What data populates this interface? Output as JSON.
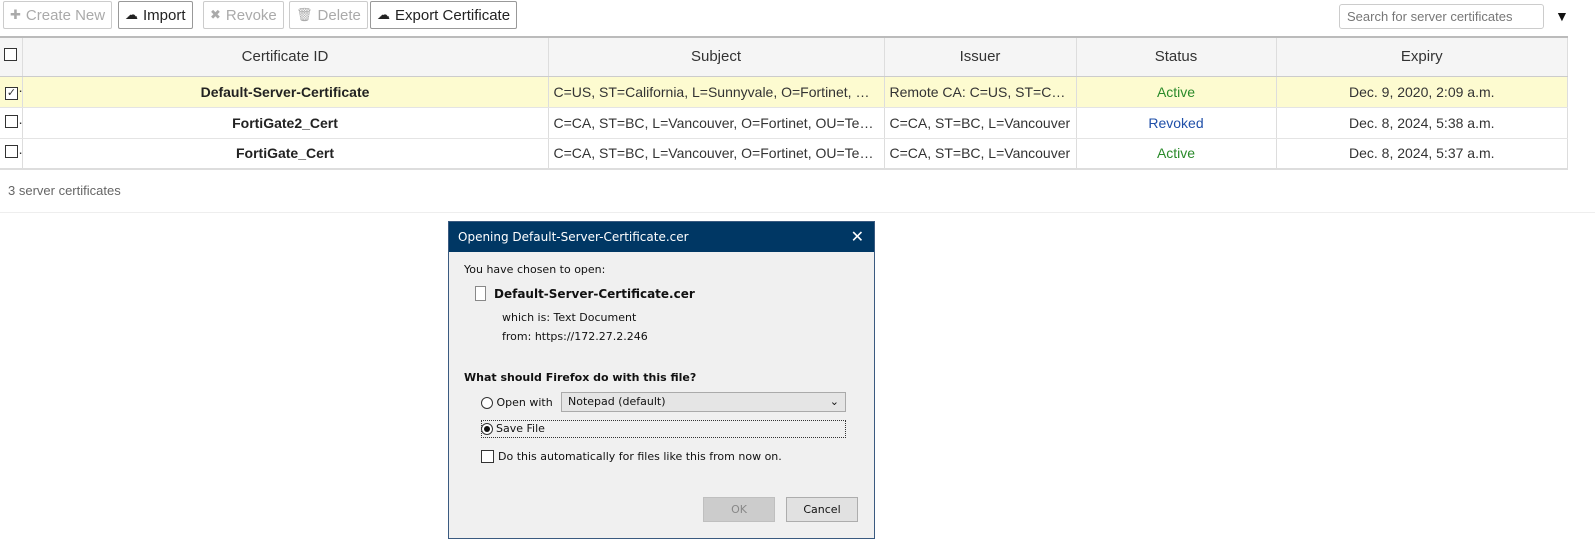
{
  "toolbar": {
    "create_new": "Create New",
    "import": "Import",
    "revoke": "Revoke",
    "delete": "Delete",
    "export": "Export Certificate",
    "search_placeholder": "Search for server certificates"
  },
  "table": {
    "headers": [
      "Certificate ID",
      "Subject",
      "Issuer",
      "Status",
      "Expiry"
    ],
    "rows": [
      {
        "id": "Default-Server-Certificate",
        "subject": "C=US, ST=California, L=Sunnyvale, O=Fortinet, OU=FortiGate",
        "issuer": "Remote CA: C=US, ST=California",
        "status": "Active",
        "expiry": "Dec. 9, 2020, 2:09 a.m.",
        "checked": true
      },
      {
        "id": "FortiGate2_Cert",
        "subject": "C=CA, ST=BC, L=Vancouver, O=Fortinet, OU=Technical",
        "issuer": "C=CA, ST=BC, L=Vancouver",
        "status": "Revoked",
        "expiry": "Dec. 8, 2024, 5:38 a.m.",
        "checked": false
      },
      {
        "id": "FortiGate_Cert",
        "subject": "C=CA, ST=BC, L=Vancouver, O=Fortinet, OU=Technical",
        "issuer": "C=CA, ST=BC, L=Vancouver",
        "status": "Active",
        "expiry": "Dec. 8, 2024, 5:37 a.m.",
        "checked": false
      }
    ]
  },
  "footer": {
    "count": "3 server certificates"
  },
  "dialog": {
    "title": "Opening Default-Server-Certificate.cer",
    "chosen": "You have chosen to open:",
    "filename": "Default-Server-Certificate.cer",
    "which_label": "which is:",
    "which_value": "Text Document",
    "from_label": "from:",
    "from_value": "https://172.27.2.246",
    "question": "What should Firefox do with this file?",
    "open_with": "Open with",
    "app": "Notepad (default)",
    "save_file": "Save File",
    "auto": "Do this automatically for files like this from now on.",
    "ok": "OK",
    "cancel": "Cancel"
  }
}
